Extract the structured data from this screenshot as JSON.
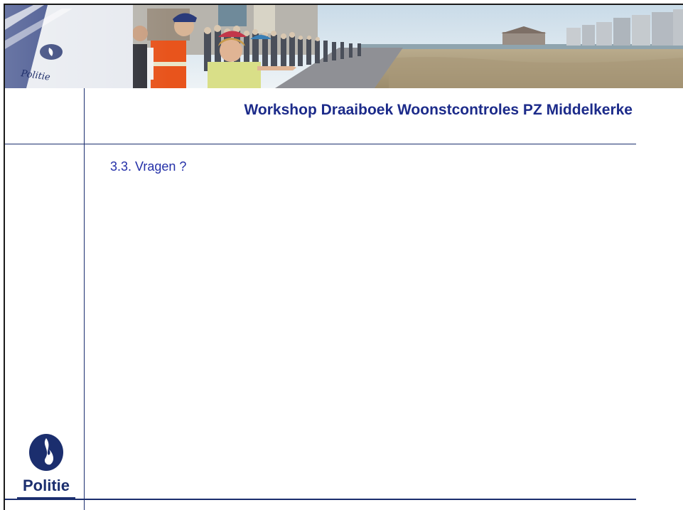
{
  "slide": {
    "title": "Workshop Draaiboek Woonstcontroles PZ Middelkerke",
    "bullet": "3.3. Vragen ?"
  },
  "banner": {
    "logo_text": "Politie"
  },
  "logo": {
    "wordmark": "Politie"
  },
  "colors": {
    "title": "#1c2b8a",
    "body_text": "#2430a8",
    "rules": "#1b2e6e"
  }
}
